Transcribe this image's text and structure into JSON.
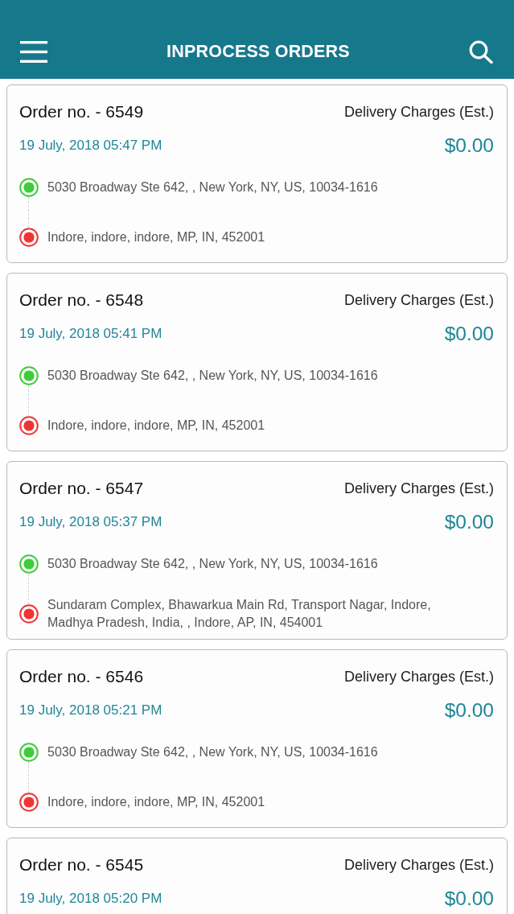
{
  "app_bar": {
    "title": "INPROCESS ORDERS"
  },
  "orders": [
    {
      "order_no": "Order no. - 6549",
      "charge_label": "Delivery Charges (Est.)",
      "date": "19 July, 2018 05:47 PM",
      "amount": "$0.00",
      "stops": [
        {
          "kind": "pickup",
          "address": "5030 Broadway Ste 642, , New York, NY, US, 10034-1616"
        },
        {
          "kind": "dropoff",
          "address": "Indore, indore, indore, MP, IN, 452001"
        }
      ]
    },
    {
      "order_no": "Order no. - 6548",
      "charge_label": "Delivery Charges (Est.)",
      "date": "19 July, 2018 05:41 PM",
      "amount": "$0.00",
      "stops": [
        {
          "kind": "pickup",
          "address": "5030 Broadway Ste 642, , New York, NY, US, 10034-1616"
        },
        {
          "kind": "dropoff",
          "address": "Indore, indore, indore, MP, IN, 452001"
        }
      ]
    },
    {
      "order_no": "Order no. - 6547",
      "charge_label": "Delivery Charges (Est.)",
      "date": "19 July, 2018 05:37 PM",
      "amount": "$0.00",
      "stops": [
        {
          "kind": "pickup",
          "address": "5030 Broadway Ste 642, , New York, NY, US, 10034-1616"
        },
        {
          "kind": "dropoff",
          "address": "Sundaram Complex, Bhawarkua Main Rd, Transport Nagar, Indore, Madhya Pradesh, India, , Indore, AP, IN, 454001"
        }
      ]
    },
    {
      "order_no": "Order no. - 6546",
      "charge_label": "Delivery Charges (Est.)",
      "date": "19 July, 2018 05:21 PM",
      "amount": "$0.00",
      "stops": [
        {
          "kind": "pickup",
          "address": "5030 Broadway Ste 642, , New York, NY, US, 10034-1616"
        },
        {
          "kind": "dropoff",
          "address": "Indore, indore, indore, MP, IN, 452001"
        }
      ]
    },
    {
      "order_no": "Order no. - 6545",
      "charge_label": "Delivery Charges (Est.)",
      "date": "19 July, 2018 05:20 PM",
      "amount": "$0.00"
    }
  ]
}
